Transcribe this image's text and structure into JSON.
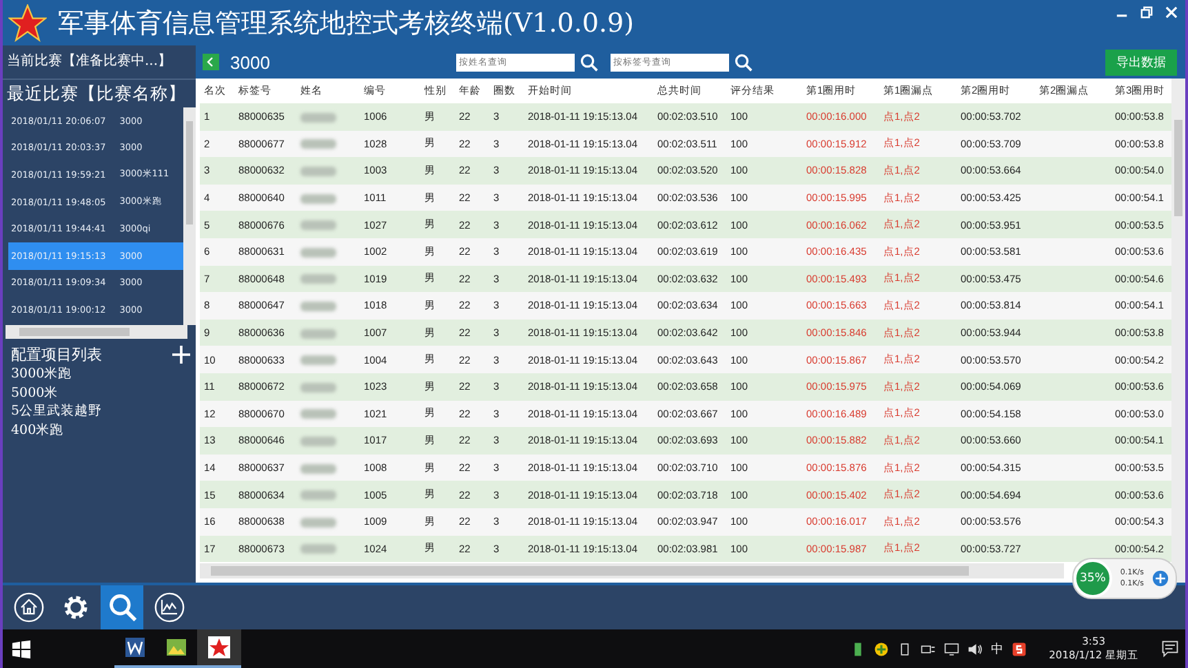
{
  "window": {
    "title": "军事体育信息管理系统地控式考核终端(V1.0.0.9)"
  },
  "sidebar": {
    "current": "当前比赛【准备比赛中...】",
    "recent_title": "最近比赛【比赛名称】",
    "recent": [
      {
        "date": "2018/01/11 20:06:07",
        "name": "3000",
        "selected": false
      },
      {
        "date": "2018/01/11 20:03:37",
        "name": "3000",
        "selected": false
      },
      {
        "date": "2018/01/11 19:59:21",
        "name": "3000米111",
        "selected": false
      },
      {
        "date": "2018/01/11 19:48:05",
        "name": "3000米跑",
        "selected": false
      },
      {
        "date": "2018/01/11 19:44:41",
        "name": "3000qi",
        "selected": false
      },
      {
        "date": "2018/01/11 19:15:13",
        "name": "3000",
        "selected": true
      },
      {
        "date": "2018/01/11 19:09:34",
        "name": "3000",
        "selected": false
      },
      {
        "date": "2018/01/11 19:00:12",
        "name": "3000",
        "selected": false
      }
    ],
    "config_title": "配置项目列表",
    "config_items": [
      "3000米跑",
      "5000米",
      "5公里武装越野",
      "400米跑"
    ]
  },
  "toolbar": {
    "title": "3000",
    "name_search": {
      "placeholder": "按姓名查询"
    },
    "tag_search": {
      "placeholder": "按标签号查询"
    },
    "export_button": "导出数据"
  },
  "table": {
    "columns": [
      {
        "label": "名次",
        "kind": "text"
      },
      {
        "label": "标签号",
        "kind": "text"
      },
      {
        "label": "姓名",
        "kind": "blurred"
      },
      {
        "label": "编号",
        "kind": "text"
      },
      {
        "label": "性别",
        "kind": "text"
      },
      {
        "label": "年龄",
        "kind": "text"
      },
      {
        "label": "圈数",
        "kind": "text"
      },
      {
        "label": "开始时间",
        "kind": "text"
      },
      {
        "label": "总共时间",
        "kind": "text"
      },
      {
        "label": "评分结果",
        "kind": "text"
      },
      {
        "label": "第1圈用时",
        "kind": "alert"
      },
      {
        "label": "第1圈漏点",
        "kind": "alert"
      },
      {
        "label": "第2圈用时",
        "kind": "text"
      },
      {
        "label": "第2圈漏点",
        "kind": "text"
      },
      {
        "label": "第3圈用时",
        "kind": "text"
      }
    ],
    "rows": [
      {
        "cells": [
          "1",
          "88000635",
          "",
          "1006",
          "男",
          "22",
          "3",
          "2018-01-11 19:15:13.04",
          "00:02:03.510",
          "100",
          "00:00:16.000",
          "点1,点2",
          "00:00:53.702",
          "",
          "00:00:53.8"
        ]
      },
      {
        "cells": [
          "2",
          "88000677",
          "",
          "1028",
          "男",
          "22",
          "3",
          "2018-01-11 19:15:13.04",
          "00:02:03.511",
          "100",
          "00:00:15.912",
          "点1,点2",
          "00:00:53.709",
          "",
          "00:00:53.8"
        ]
      },
      {
        "cells": [
          "3",
          "88000632",
          "",
          "1003",
          "男",
          "22",
          "3",
          "2018-01-11 19:15:13.04",
          "00:02:03.520",
          "100",
          "00:00:15.828",
          "点1,点2",
          "00:00:53.664",
          "",
          "00:00:54.0"
        ]
      },
      {
        "cells": [
          "4",
          "88000640",
          "",
          "1011",
          "男",
          "22",
          "3",
          "2018-01-11 19:15:13.04",
          "00:02:03.536",
          "100",
          "00:00:15.995",
          "点1,点2",
          "00:00:53.425",
          "",
          "00:00:54.1"
        ]
      },
      {
        "cells": [
          "5",
          "88000676",
          "",
          "1027",
          "男",
          "22",
          "3",
          "2018-01-11 19:15:13.04",
          "00:02:03.612",
          "100",
          "00:00:16.062",
          "点1,点2",
          "00:00:53.951",
          "",
          "00:00:53.5"
        ]
      },
      {
        "cells": [
          "6",
          "88000631",
          "",
          "1002",
          "男",
          "22",
          "3",
          "2018-01-11 19:15:13.04",
          "00:02:03.619",
          "100",
          "00:00:16.435",
          "点1,点2",
          "00:00:53.581",
          "",
          "00:00:53.6"
        ]
      },
      {
        "cells": [
          "7",
          "88000648",
          "",
          "1019",
          "男",
          "22",
          "3",
          "2018-01-11 19:15:13.04",
          "00:02:03.632",
          "100",
          "00:00:15.493",
          "点1,点2",
          "00:00:53.475",
          "",
          "00:00:54.6"
        ]
      },
      {
        "cells": [
          "8",
          "88000647",
          "",
          "1018",
          "男",
          "22",
          "3",
          "2018-01-11 19:15:13.04",
          "00:02:03.634",
          "100",
          "00:00:15.663",
          "点1,点2",
          "00:00:53.814",
          "",
          "00:00:54.1"
        ]
      },
      {
        "cells": [
          "9",
          "88000636",
          "",
          "1007",
          "男",
          "22",
          "3",
          "2018-01-11 19:15:13.04",
          "00:02:03.642",
          "100",
          "00:00:15.846",
          "点1,点2",
          "00:00:53.944",
          "",
          "00:00:53.8"
        ]
      },
      {
        "cells": [
          "10",
          "88000633",
          "",
          "1004",
          "男",
          "22",
          "3",
          "2018-01-11 19:15:13.04",
          "00:02:03.643",
          "100",
          "00:00:15.867",
          "点1,点2",
          "00:00:53.570",
          "",
          "00:00:54.2"
        ]
      },
      {
        "cells": [
          "11",
          "88000672",
          "",
          "1023",
          "男",
          "22",
          "3",
          "2018-01-11 19:15:13.04",
          "00:02:03.658",
          "100",
          "00:00:15.975",
          "点1,点2",
          "00:00:54.069",
          "",
          "00:00:53.6"
        ]
      },
      {
        "cells": [
          "12",
          "88000670",
          "",
          "1021",
          "男",
          "22",
          "3",
          "2018-01-11 19:15:13.04",
          "00:02:03.667",
          "100",
          "00:00:16.489",
          "点1,点2",
          "00:00:54.158",
          "",
          "00:00:53.0"
        ]
      },
      {
        "cells": [
          "13",
          "88000646",
          "",
          "1017",
          "男",
          "22",
          "3",
          "2018-01-11 19:15:13.04",
          "00:02:03.693",
          "100",
          "00:00:15.882",
          "点1,点2",
          "00:00:53.660",
          "",
          "00:00:54.1"
        ]
      },
      {
        "cells": [
          "14",
          "88000637",
          "",
          "1008",
          "男",
          "22",
          "3",
          "2018-01-11 19:15:13.04",
          "00:02:03.710",
          "100",
          "00:00:15.876",
          "点1,点2",
          "00:00:54.315",
          "",
          "00:00:53.5"
        ]
      },
      {
        "cells": [
          "15",
          "88000634",
          "",
          "1005",
          "男",
          "22",
          "3",
          "2018-01-11 19:15:13.04",
          "00:02:03.718",
          "100",
          "00:00:15.402",
          "点1,点2",
          "00:00:54.694",
          "",
          "00:00:53.6"
        ]
      },
      {
        "cells": [
          "16",
          "88000638",
          "",
          "1009",
          "男",
          "22",
          "3",
          "2018-01-11 19:15:13.04",
          "00:02:03.947",
          "100",
          "00:00:16.017",
          "点1,点2",
          "00:00:53.576",
          "",
          "00:00:54.3"
        ]
      },
      {
        "cells": [
          "17",
          "88000673",
          "",
          "1024",
          "男",
          "22",
          "3",
          "2018-01-11 19:15:13.04",
          "00:02:03.981",
          "100",
          "00:00:15.987",
          "点1,点2",
          "00:00:53.727",
          "",
          "00:00:54.2"
        ]
      }
    ]
  },
  "speed_widget": {
    "percent": "35%",
    "upload": "0.1K/s",
    "download": "0.1K/s"
  },
  "bottom_nav": [
    {
      "kind": "home",
      "selected": false
    },
    {
      "kind": "settings",
      "selected": false
    },
    {
      "kind": "search",
      "selected": true
    },
    {
      "kind": "chart",
      "selected": false
    }
  ],
  "taskbar": {
    "ime": "中",
    "time": "3:53",
    "date": "2018/1/12 星期五"
  }
}
